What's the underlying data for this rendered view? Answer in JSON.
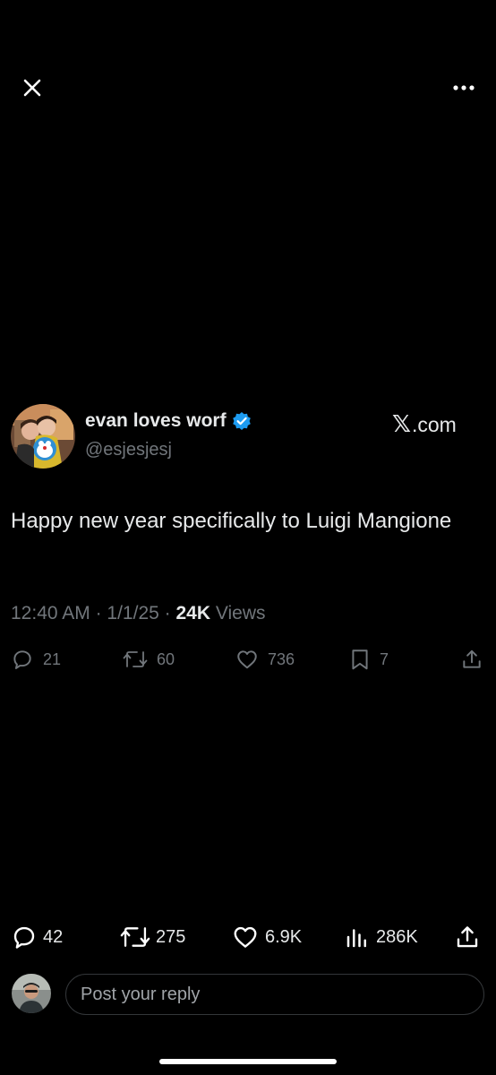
{
  "colors": {
    "background": "#000000",
    "text_primary": "#e7e9ea",
    "text_secondary": "#71767b",
    "verified_blue": "#1d9bf0"
  },
  "topbar": {
    "close_icon": "close-icon",
    "more_icon": "more-horizontal-icon"
  },
  "tweet": {
    "display_name": "evan loves worf",
    "verified_icon": "verified-badge-icon",
    "handle": "@esjesjesj",
    "source_x": "𝕏",
    "source_domain": ".com",
    "text": "Happy new year specifically to Luigi Mangione",
    "time": "12:40 AM",
    "date": "1/1/25",
    "sep": "·",
    "views_count": "24K",
    "views_label": "Views",
    "stats": {
      "replies": "21",
      "reposts": "60",
      "likes": "736",
      "bookmarks": "7"
    }
  },
  "engagement_bar": {
    "replies": "42",
    "reposts": "275",
    "likes": "6.9K",
    "views": "286K"
  },
  "reply": {
    "placeholder": "Post your reply"
  }
}
